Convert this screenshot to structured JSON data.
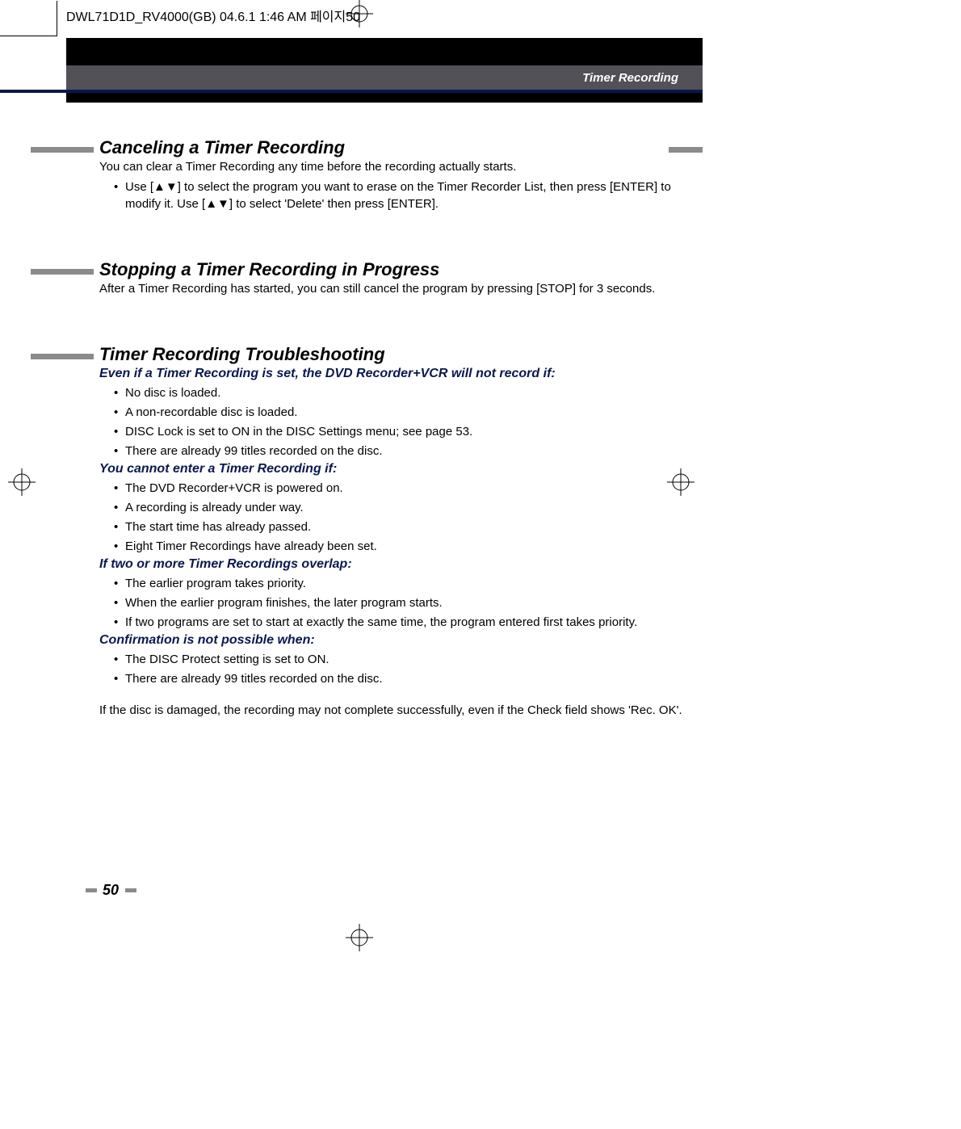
{
  "header": {
    "file_info": "DWL71D1D_RV4000(GB)  04.6.1 1:46 AM  페이지50",
    "banner_title": "Timer Recording"
  },
  "sections": [
    {
      "title": "Canceling a Timer Recording",
      "intro": "You can clear a Timer Recording any time before the recording actually starts.",
      "bullets": [
        "Use [▲▼] to select the program you want to erase on the Timer Recorder List, then press [ENTER] to modify it. Use [▲▼] to select 'Delete' then press [ENTER]."
      ]
    },
    {
      "title": "Stopping a Timer Recording in Progress",
      "intro": "After a Timer Recording has started, you can still cancel the program by pressing [STOP] for 3 seconds."
    },
    {
      "title": "Timer Recording Troubleshooting",
      "groups": [
        {
          "heading": "Even if a Timer Recording is set, the DVD Recorder+VCR will not record if:",
          "items": [
            "No disc is loaded.",
            "A non-recordable disc is loaded.",
            "DISC Lock is set to ON in the DISC Settings menu; see page 53.",
            "There are already 99 titles recorded on the disc."
          ]
        },
        {
          "heading": "You cannot enter a Timer Recording if:",
          "items": [
            "The DVD Recorder+VCR is powered on.",
            "A recording is already under way.",
            "The start time has already passed.",
            "Eight Timer Recordings have already been set."
          ]
        },
        {
          "heading": "If two or more Timer Recordings overlap:",
          "items": [
            "The earlier program takes priority.",
            "When the earlier program finishes, the later program starts.",
            "If two programs are set to start at exactly the same time, the program entered first takes priority."
          ]
        },
        {
          "heading": "Confirmation is not possible when:",
          "items": [
            "The DISC Protect setting is set to ON.",
            "There are already 99 titles recorded on the disc."
          ]
        }
      ],
      "footer": "If the disc is damaged, the recording may not complete successfully, even if the Check field shows 'Rec. OK'."
    }
  ],
  "page_number": "50"
}
